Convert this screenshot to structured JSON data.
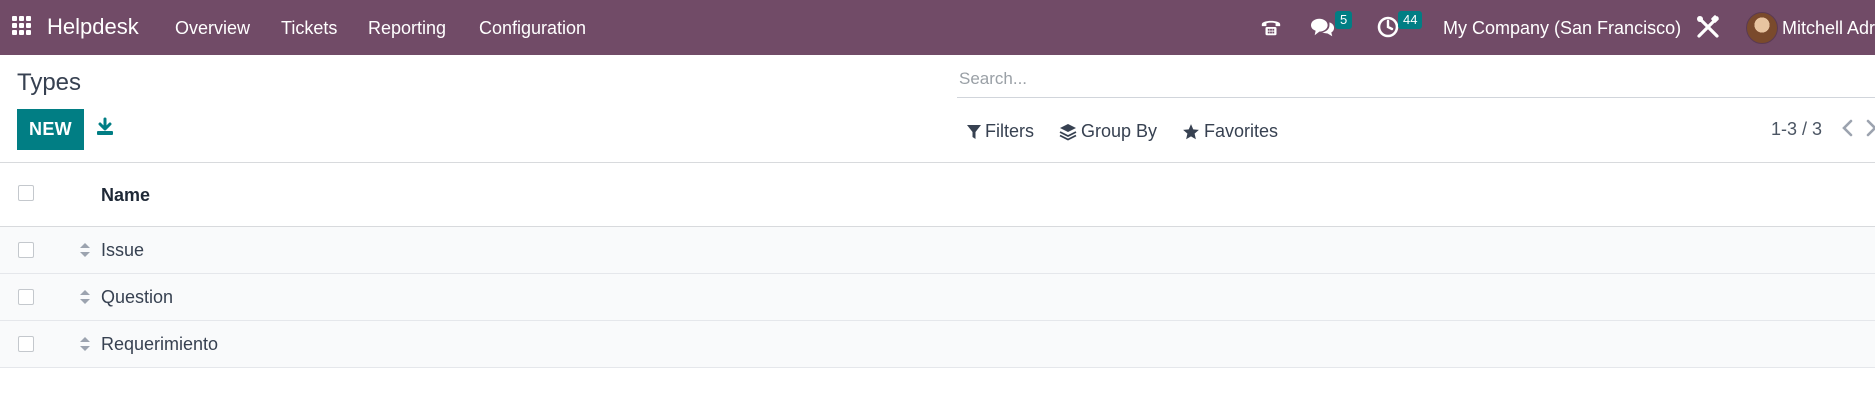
{
  "navbar": {
    "app_name": "Helpdesk",
    "menu": [
      "Overview",
      "Tickets",
      "Reporting",
      "Configuration"
    ],
    "messages_count": "5",
    "activities_count": "44",
    "company": "My Company (San Francisco)",
    "user": "Mitchell Adr",
    "icons": [
      "apps-grid-icon",
      "phone-icon",
      "chat-icon",
      "clock-icon",
      "debug-tools-icon"
    ],
    "colors": {
      "bar": "#714b67",
      "badge": "#017e84"
    }
  },
  "control_panel": {
    "title": "Types",
    "new_label": "NEW",
    "search_placeholder": "Search...",
    "filters_label": "Filters",
    "group_by_label": "Group By",
    "favorites_label": "Favorites",
    "pager": "1-3 / 3",
    "colors": {
      "primary": "#017e84"
    }
  },
  "list": {
    "column_name": "Name",
    "rows": [
      "Issue",
      "Question",
      "Requerimiento"
    ]
  }
}
